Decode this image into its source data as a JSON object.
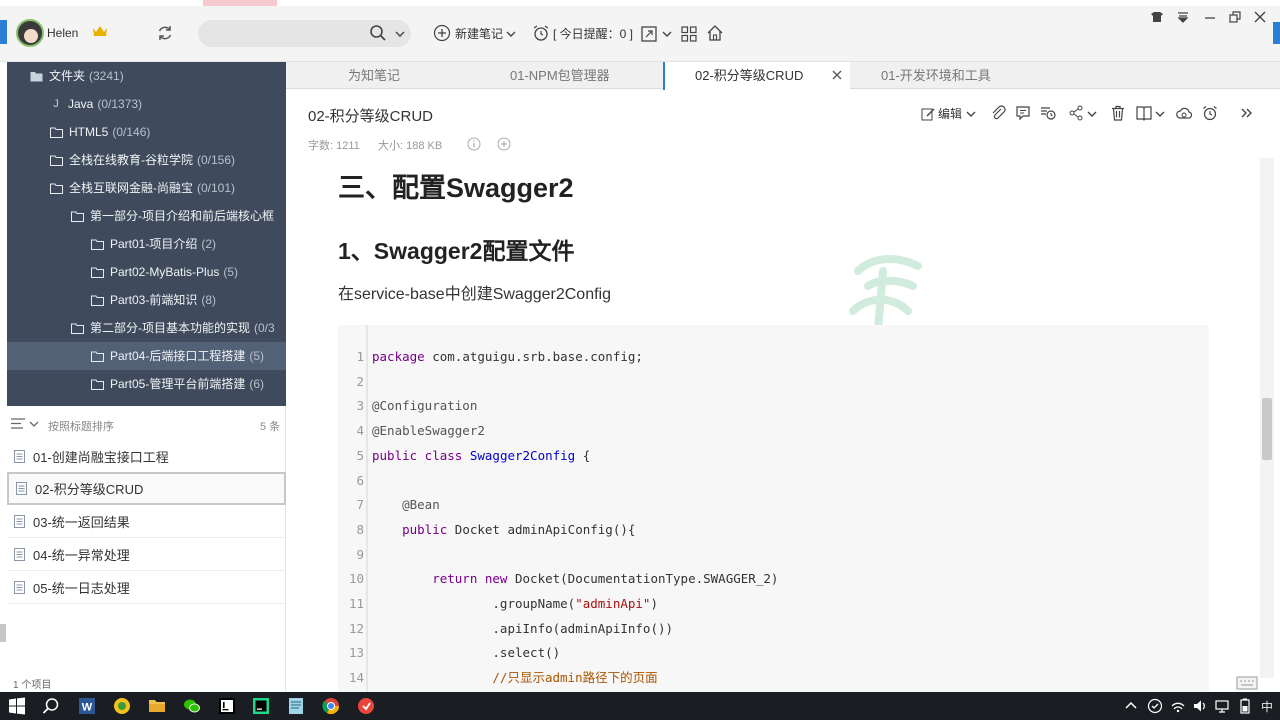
{
  "user": {
    "name": "Helen"
  },
  "toolbar": {
    "new_note": "新建笔记",
    "reminder": "[ 今日提醒：0 ]"
  },
  "sidebar": {
    "items": [
      {
        "label": "文件夹",
        "count": "(3241)",
        "icon": "folder-icon"
      },
      {
        "label": "Java",
        "count": "(0/1373)",
        "icon": "java-icon"
      },
      {
        "label": "HTML5",
        "count": "(0/146)",
        "icon": "folder-icon"
      },
      {
        "label": "全栈在线教育-谷粒学院",
        "count": "(0/156)",
        "icon": "folder-icon"
      },
      {
        "label": "全栈互联网金融-尚融宝",
        "count": "(0/101)",
        "icon": "folder-icon"
      },
      {
        "label": "第一部分-项目介绍和前后端核心框",
        "count": "",
        "icon": "folder-icon"
      },
      {
        "label": "Part01-项目介绍",
        "count": "(2)",
        "icon": "folder-icon"
      },
      {
        "label": "Part02-MyBatis-Plus",
        "count": "(5)",
        "icon": "folder-icon"
      },
      {
        "label": "Part03-前端知识",
        "count": "(8)",
        "icon": "folder-icon"
      },
      {
        "label": "第二部分-项目基本功能的实现",
        "count": "(0/3",
        "icon": "folder-icon"
      },
      {
        "label": "Part04-后端接口工程搭建",
        "count": "(5)",
        "icon": "folder-icon"
      },
      {
        "label": "Part05-管理平台前端搭建",
        "count": "(6)",
        "icon": "folder-icon"
      }
    ]
  },
  "notelist": {
    "sort_label": "按照标题排序",
    "count": "5 条",
    "items": [
      "01-创建尚融宝接口工程",
      "02-积分等级CRUD",
      "03-统一返回结果",
      "04-统一异常处理",
      "05-统一日志处理"
    ],
    "status": "1 个项目"
  },
  "tabs": [
    {
      "label": "为知笔记"
    },
    {
      "label": "01-NPM包管理器"
    },
    {
      "label": "02-积分等级CRUD"
    },
    {
      "label": "01-开发环境和工具"
    }
  ],
  "note": {
    "title": "02-积分等级CRUD",
    "word_count": "字数: 1211",
    "size": "大小: 188 KB",
    "edit_label": "编辑"
  },
  "content": {
    "h2": "三、配置Swagger2",
    "h3": "1、Swagger2配置文件",
    "para": "在service-base中创建Swagger2Config"
  },
  "code": [
    {
      "n": "1",
      "parts": [
        [
          "kw",
          "package"
        ],
        [
          "",
          "&nbsp;com.atguigu.srb.base.config;"
        ]
      ]
    },
    {
      "n": "2",
      "parts": []
    },
    {
      "n": "3",
      "parts": [
        [
          "an",
          "@Configuration"
        ]
      ]
    },
    {
      "n": "4",
      "parts": [
        [
          "an",
          "@EnableSwagger2"
        ]
      ]
    },
    {
      "n": "5",
      "parts": [
        [
          "kw",
          "public class"
        ],
        [
          "",
          "&nbsp;"
        ],
        [
          "ty",
          "Swagger2Config"
        ],
        [
          "",
          "&nbsp;{"
        ]
      ]
    },
    {
      "n": "6",
      "parts": []
    },
    {
      "n": "7",
      "parts": [
        [
          "an",
          "    @Bean"
        ]
      ]
    },
    {
      "n": "8",
      "parts": [
        [
          "kw",
          "    public"
        ],
        [
          "",
          "&nbsp;Docket adminApiConfig(){"
        ]
      ]
    },
    {
      "n": "9",
      "parts": []
    },
    {
      "n": "10",
      "parts": [
        [
          "kw",
          "        return new"
        ],
        [
          "",
          "&nbsp;Docket(DocumentationType.SWAGGER_2)"
        ]
      ]
    },
    {
      "n": "11",
      "parts": [
        [
          "",
          "                .groupName("
        ],
        [
          "str",
          "\"adminApi\""
        ],
        [
          "",
          ")"
        ]
      ]
    },
    {
      "n": "12",
      "parts": [
        [
          "",
          "                .apiInfo(adminApiInfo())"
        ]
      ]
    },
    {
      "n": "13",
      "parts": [
        [
          "",
          "                .select()"
        ]
      ]
    },
    {
      "n": "14",
      "parts": [
        [
          "cm",
          "                //只显示admin路径下的页面"
        ]
      ]
    }
  ],
  "taskbar": {
    "lang": "中"
  },
  "colors": {
    "sidebar_bg": "#3f4b5c",
    "accent": "#2a7fd4",
    "keyword": "#770088",
    "type": "#0000cc",
    "string": "#aa1111"
  }
}
